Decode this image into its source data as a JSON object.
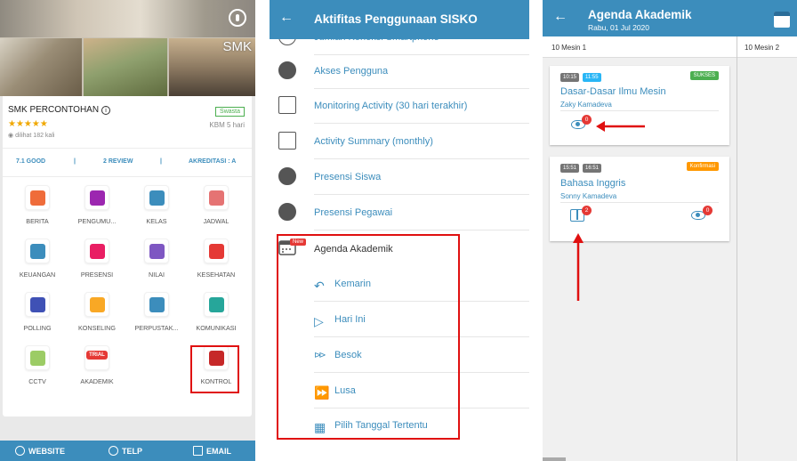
{
  "left_app": {
    "hero_label": "SMK",
    "school_name": "SMK PERCONTOHAN",
    "stars": "★★★★★",
    "views": "dilihat 182 kali",
    "school_type": "Swasta",
    "kbm": "KBM 5 hari",
    "stats": {
      "good": "7.1 GOOD",
      "review": "2 REVIEW",
      "accreditation": "AKREDITASI : A"
    },
    "menu": [
      {
        "label": "BERITA",
        "icon": "news-icon",
        "color": "#ef6c3a"
      },
      {
        "label": "PENGUMU...",
        "icon": "megaphone-icon",
        "color": "#9c27b0"
      },
      {
        "label": "KELAS",
        "icon": "classroom-icon",
        "color": "#3c8dbc"
      },
      {
        "label": "JADWAL",
        "icon": "calendar-icon",
        "color": "#e57373"
      },
      {
        "label": "KEUANGAN",
        "icon": "money-icon",
        "color": "#3c8dbc"
      },
      {
        "label": "PRESENSI",
        "icon": "clipboard-icon",
        "color": "#e91e63"
      },
      {
        "label": "NILAI",
        "icon": "grade-icon",
        "color": "#7e57c2"
      },
      {
        "label": "KESEHATAN",
        "icon": "medkit-icon",
        "color": "#e53935"
      },
      {
        "label": "POLLING",
        "icon": "ballot-icon",
        "color": "#3f51b5"
      },
      {
        "label": "KONSELING",
        "icon": "people-icon",
        "color": "#f9a825"
      },
      {
        "label": "PERPUSTAK...",
        "icon": "book-icon",
        "color": "#3c8dbc"
      },
      {
        "label": "KOMUNIKASI",
        "icon": "chat-icon",
        "color": "#26a69a"
      },
      {
        "label": "CCTV",
        "icon": "cctv-icon",
        "color": "#9ccc65"
      },
      {
        "label": "AKADEMIK",
        "icon": "trial-icon",
        "color": "#e53935"
      },
      {
        "label": "KONTROL",
        "icon": "control-book-icon",
        "color": "#c62828"
      }
    ],
    "trial_text": "TRIAL",
    "bottom": {
      "website": "WEBSITE",
      "telp": "TELP",
      "email": "EMAIL"
    },
    "colors": {
      "primary": "#3c8dbc",
      "highlight": "#e01010"
    }
  },
  "middle_app": {
    "title": "Aktifitas Penggunaan SISKO",
    "items": [
      {
        "label": "Jumlah Koneksi Smartphone",
        "icon": "smartphone-icon"
      },
      {
        "label": "Akses Pengguna",
        "icon": "star-icon"
      },
      {
        "label": "Monitoring Activity (30 hari terakhir)",
        "icon": "list-icon"
      },
      {
        "label": "Activity Summary (monthly)",
        "icon": "report-icon"
      },
      {
        "label": "Presensi Siswa",
        "icon": "student-icon"
      },
      {
        "label": "Presensi Pegawai",
        "icon": "staff-icon"
      }
    ],
    "agenda_label": "Agenda Akademik",
    "new_badge": "New",
    "sub_items": [
      {
        "label": "Kemarin",
        "icon": "undo-icon",
        "glyph": "↶"
      },
      {
        "label": "Hari Ini",
        "icon": "play-icon",
        "glyph": "▷"
      },
      {
        "label": "Besok",
        "icon": "fast-forward-icon",
        "glyph": "⊳⊳"
      },
      {
        "label": "Lusa",
        "icon": "circle-forward-icon",
        "glyph": "⏩"
      },
      {
        "label": "Pilih Tanggal Tertentu",
        "icon": "calendar-grid-icon",
        "glyph": "▦"
      }
    ]
  },
  "right_app": {
    "title": "Agenda Akademik",
    "subtitle": "Rabu, 01 Jul 2020",
    "columns": [
      "10 Mesin 1",
      "10 Mesin 2"
    ],
    "events": [
      {
        "start": "10:15",
        "end": "11:55",
        "status": "SUKSES",
        "status_color": "#4caf50",
        "subject": "Dasar-Dasar Ilmu Mesin",
        "teacher": "Zaky Kamadeva",
        "eye_count": "0"
      },
      {
        "start": "15:51",
        "end": "16:51",
        "status": "Konfirmasi",
        "status_color": "#ff9800",
        "subject": "Bahasa Inggris",
        "teacher": "Sonny Kamadeva",
        "book_count": "2",
        "eye_count": "0"
      }
    ]
  }
}
